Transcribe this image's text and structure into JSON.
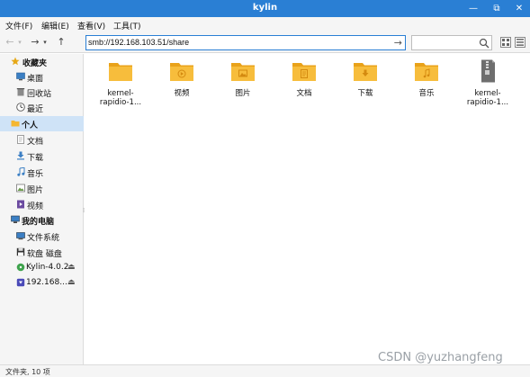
{
  "window": {
    "title": "kylin",
    "controls": {
      "minimize": "—",
      "maximize": "⧉",
      "close": "✕"
    }
  },
  "menu": {
    "items": [
      "文件(F)",
      "编辑(E)",
      "查看(V)",
      "工具(T)"
    ]
  },
  "toolbar": {
    "back": "←",
    "forward": "→",
    "up": "↑",
    "address_value": "smb://192.168.103.51/share",
    "go": "→",
    "search_placeholder": ""
  },
  "sidebar": {
    "items": [
      {
        "label": "收藏夹",
        "icon": "star-icon",
        "type": "header"
      },
      {
        "label": "桌面",
        "icon": "desktop-icon"
      },
      {
        "label": "回收站",
        "icon": "trash-icon"
      },
      {
        "label": "最近",
        "icon": "clock-icon"
      },
      {
        "label": "个人",
        "icon": "folder-icon",
        "type": "header",
        "selected": true
      },
      {
        "label": "文档",
        "icon": "document-icon"
      },
      {
        "label": "下载",
        "icon": "download-icon"
      },
      {
        "label": "音乐",
        "icon": "music-icon"
      },
      {
        "label": "图片",
        "icon": "picture-icon"
      },
      {
        "label": "视频",
        "icon": "video-icon"
      },
      {
        "label": "我的电脑",
        "icon": "computer-icon",
        "type": "header"
      },
      {
        "label": "文件系统",
        "icon": "filesystem-icon"
      },
      {
        "label": "软盘 磁盘",
        "icon": "floppy-icon"
      },
      {
        "label": "Kylin-4.0.2",
        "icon": "disc-icon",
        "eject": "⏏"
      },
      {
        "label": "192.168....",
        "icon": "network-drive-icon",
        "eject": "⏏"
      }
    ]
  },
  "files": [
    {
      "name": "kernel-rapidio-1...",
      "icon": "folder-icon"
    },
    {
      "name": "视频",
      "icon": "video-folder-icon"
    },
    {
      "name": "图片",
      "icon": "picture-folder-icon"
    },
    {
      "name": "文档",
      "icon": "document-folder-icon"
    },
    {
      "name": "下载",
      "icon": "download-folder-icon"
    },
    {
      "name": "音乐",
      "icon": "music-folder-icon"
    },
    {
      "name": "kernel-rapidio-1...",
      "icon": "archive-file-icon"
    }
  ],
  "status": {
    "text": "文件夹, 10 项"
  },
  "watermark": "CSDN @yuzhangfeng",
  "colors": {
    "titlebar": "#2a7fd4",
    "folder": "#f5b731",
    "selected": "#cfe3f7"
  }
}
